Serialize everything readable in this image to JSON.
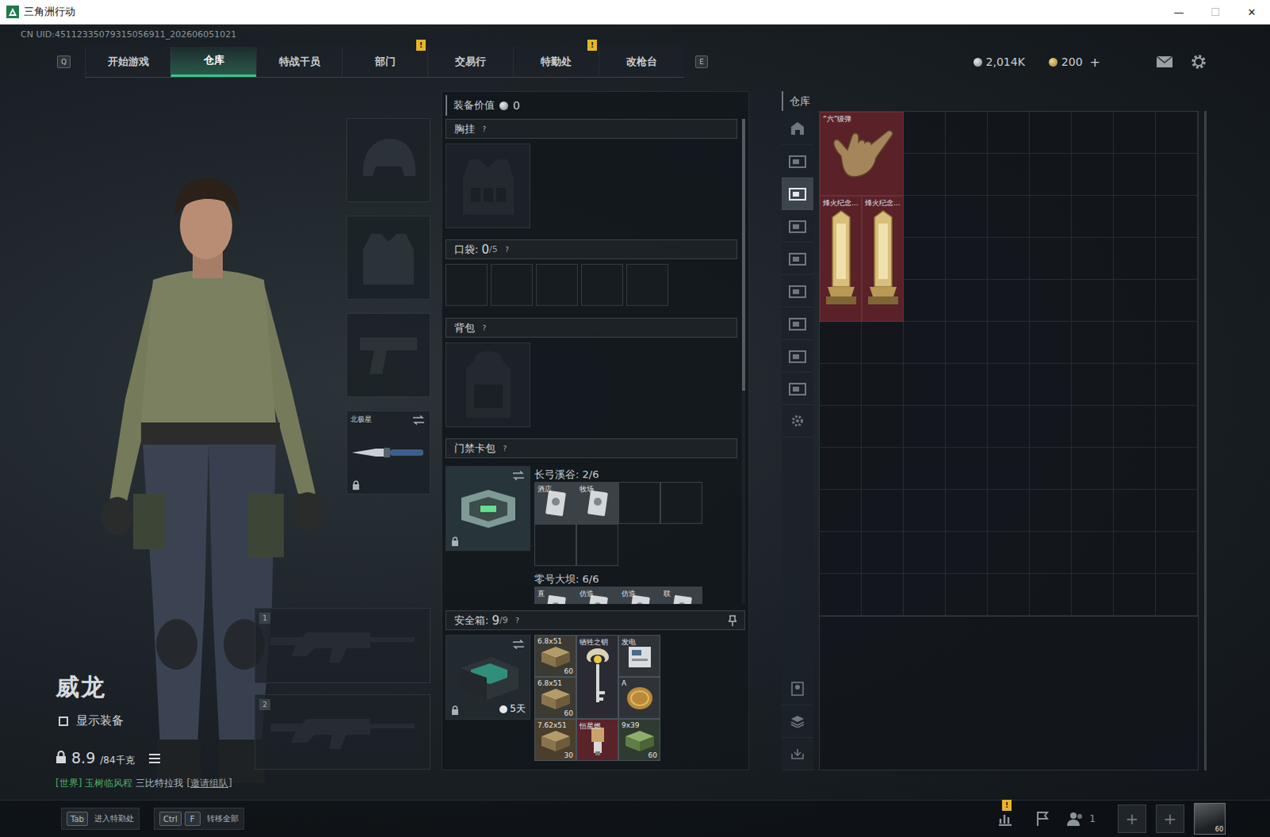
{
  "window": {
    "title": "三角洲行动",
    "controls": [
      {
        "glyph": "—",
        "disabled": false
      },
      {
        "glyph": "☐",
        "disabled": true
      },
      {
        "glyph": "✕",
        "disabled": false
      }
    ]
  },
  "uid": "CN UID:45112335079315056911_202606051021",
  "nav": {
    "prev_key": "Q",
    "next_key": "E",
    "tabs": [
      {
        "label": "开始游戏",
        "selected": false,
        "badge": ""
      },
      {
        "label": "仓库",
        "selected": true,
        "badge": ""
      },
      {
        "label": "特战干员",
        "selected": false,
        "badge": ""
      },
      {
        "label": "部门",
        "selected": false,
        "badge": "!"
      },
      {
        "label": "交易行",
        "selected": false,
        "badge": ""
      },
      {
        "label": "特勤处",
        "selected": false,
        "badge": "!"
      },
      {
        "label": "改枪台",
        "selected": false,
        "badge": ""
      }
    ]
  },
  "currency": [
    {
      "kind": "silver",
      "amount": "2,014K",
      "add": ""
    },
    {
      "kind": "gold",
      "amount": "200",
      "add": "+"
    }
  ],
  "operator": {
    "name": "威龙",
    "show_gear": {
      "label": "显示装备",
      "checked": false
    },
    "weight": "8.9",
    "capacity": "/84千克"
  },
  "chat": {
    "channel": "[世界]",
    "sender": "玉树临风程",
    "message": "三比特拉我",
    "action": "[邀请组队]"
  },
  "gear_slots": [
    {
      "kind": "helmet",
      "label": "",
      "locked": false,
      "swap": false
    },
    {
      "kind": "armor",
      "label": "",
      "locked": false,
      "swap": false
    },
    {
      "kind": "pistol",
      "label": "",
      "locked": false,
      "swap": false
    },
    {
      "kind": "melee",
      "label": "北极星",
      "locked": true,
      "swap": true
    }
  ],
  "weapon_slots": [
    {
      "number": "1"
    },
    {
      "number": "2"
    }
  ],
  "loadout": {
    "value_label": "装备价值",
    "value": "0",
    "scrollbar": {
      "level": 0.56
    },
    "chest_rig": {
      "label": "胸挂",
      "help": "?"
    },
    "pockets": {
      "label": "口袋:",
      "count": "0",
      "max": "/5",
      "help": "?",
      "slots": [
        {
          "filled": false
        },
        {
          "filled": false
        },
        {
          "filled": false
        },
        {
          "filled": false
        },
        {
          "filled": false
        }
      ]
    },
    "backpack": {
      "label": "背包",
      "help": "?"
    },
    "keycard": {
      "label": "门禁卡包",
      "help": "?",
      "locked": true,
      "swap": true,
      "maps": [
        {
          "title": "长弓溪谷: 2/6",
          "cells": [
            {
              "label": "酒店",
              "filled": true
            },
            {
              "label": "牧场",
              "filled": true
            },
            {
              "label": "",
              "filled": false
            },
            {
              "label": "",
              "filled": false
            },
            {
              "label": "",
              "filled": false
            },
            {
              "label": "",
              "filled": false
            }
          ]
        },
        {
          "title": "零号大坝: 6/6",
          "cells": [
            {
              "label": "直",
              "filled": true
            },
            {
              "label": "仿造",
              "filled": true
            },
            {
              "label": "仿造",
              "filled": true
            },
            {
              "label": "联",
              "filled": true
            }
          ]
        }
      ]
    },
    "safe_box": {
      "label": "安全箱:",
      "count": "9",
      "max": "/9",
      "help": "?",
      "timer": "5天",
      "locked": true,
      "swap": true,
      "items": [
        {
          "label": "6.8x51",
          "count": "60",
          "kind": "ammo",
          "color": "#3b3a33",
          "col": 1,
          "row": 1,
          "cols": 1,
          "rows": 1
        },
        {
          "label": "牺牲之钥",
          "count": "",
          "kind": "key",
          "color": "#2a2a33",
          "col": 2,
          "row": 1,
          "cols": 1,
          "rows": 2
        },
        {
          "label": "发电",
          "count": "",
          "kind": "device",
          "color": "#2f3338",
          "col": 3,
          "row": 1,
          "cols": 1,
          "rows": 1
        },
        {
          "label": "6.8x51",
          "count": "60",
          "kind": "ammo",
          "color": "#3b3a33",
          "col": 1,
          "row": 2,
          "cols": 1,
          "rows": 1
        },
        {
          "label": "A",
          "count": "",
          "kind": "coin",
          "color": "#2f3338",
          "col": 3,
          "row": 2,
          "cols": 1,
          "rows": 1
        },
        {
          "label": "7.62x51",
          "count": "30",
          "kind": "ammo",
          "color": "#4a3e2c",
          "col": 1,
          "row": 3,
          "cols": 1,
          "rows": 1
        },
        {
          "label": "恒星燃",
          "count": "",
          "kind": "part",
          "color": "#5a2229",
          "col": 2,
          "row": 3,
          "cols": 1,
          "rows": 1
        },
        {
          "label": "9x39",
          "count": "60",
          "kind": "ammo-green",
          "color": "#2f3a30",
          "col": 3,
          "row": 3,
          "cols": 1,
          "rows": 1
        }
      ]
    }
  },
  "warehouse": {
    "title": "仓库",
    "side_tabs": [
      {
        "kind": "home",
        "selected": false
      },
      {
        "kind": "box",
        "selected": false
      },
      {
        "kind": "box",
        "selected": true
      },
      {
        "kind": "box",
        "selected": false
      },
      {
        "kind": "box",
        "selected": false
      },
      {
        "kind": "box",
        "selected": false
      },
      {
        "kind": "box",
        "selected": false
      },
      {
        "kind": "box",
        "selected": false
      },
      {
        "kind": "box",
        "selected": false
      },
      {
        "kind": "settings",
        "selected": false
      }
    ],
    "bottom_tabs": [
      {
        "kind": "operator"
      },
      {
        "kind": "layers"
      },
      {
        "kind": "sort"
      }
    ],
    "items": [
      {
        "label": "“六”级弹",
        "kind": "hand",
        "color": "#5a2129",
        "col": 1,
        "row": 1,
        "cols": 2,
        "rows": 2
      },
      {
        "label": "烽火纪念...",
        "kind": "trophy",
        "color": "#5a2129",
        "col": 1,
        "row": 3,
        "cols": 1,
        "rows": 3
      },
      {
        "label": "烽火纪念...",
        "kind": "trophy",
        "color": "#5a2129",
        "col": 2,
        "row": 3,
        "cols": 1,
        "rows": 3
      }
    ]
  },
  "bottom_bar": {
    "hints": [
      {
        "keys": [
          "Tab"
        ],
        "label": "进入特勤处"
      },
      {
        "keys": [
          "Ctrl",
          "F"
        ],
        "label": "转移全部"
      }
    ],
    "stats_badge": "!",
    "friends": "1",
    "party_slots": [
      {
        "glyph": "+"
      },
      {
        "glyph": "+"
      }
    ],
    "avatar_level": "60"
  }
}
